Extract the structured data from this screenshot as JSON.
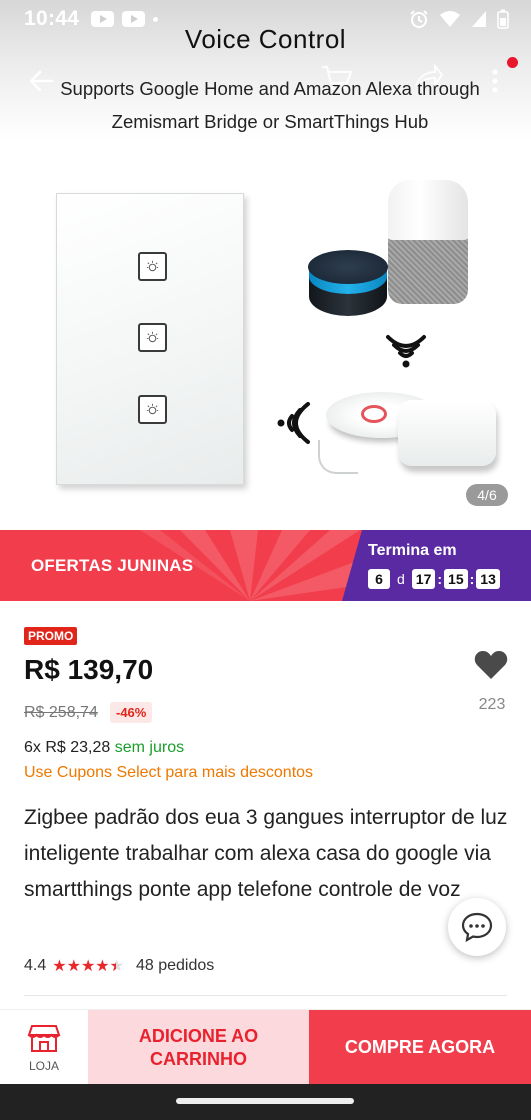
{
  "status_bar": {
    "time": "10:44"
  },
  "hero": {
    "title": "Voice Control",
    "subtitle": "Supports Google Home and Amazon Alexa through Zemismart Bridge or SmartThings Hub",
    "counter": "4/6"
  },
  "banner": {
    "label": "OFERTAS JUNINAS",
    "timer_title": "Termina em",
    "days": "6",
    "days_unit": "d",
    "hours": "17",
    "minutes": "15",
    "seconds": "13"
  },
  "price": {
    "badge": "PROMO",
    "current": "R$ 139,70",
    "original": "R$ 258,74",
    "discount": "-46%",
    "installments_prefix": "6x R$ 23,28",
    "installments_suffix": "sem juros",
    "coupons": "Use Cupons Select para mais descontos"
  },
  "favorites": {
    "count": "223"
  },
  "product": {
    "title": "Zigbee padrão dos eua 3 gangues interruptor de luz inteligente trabalhar com alexa casa do google via smartthings ponte app telefone controle de voz",
    "rating": "4.4",
    "rating_stars": 4.4,
    "orders": "48 pedidos"
  },
  "action_bar": {
    "store_label": "LOJA",
    "add_to_cart": "ADICIONE AO CARRINHO",
    "buy_now": "COMPRE AGORA"
  },
  "colors": {
    "accent_red": "#f23d4c",
    "timer_purple": "#5a2aa3",
    "promo_red": "#e1251b",
    "coupon_orange": "#ee7800",
    "installment_green": "#1a9e2c"
  }
}
